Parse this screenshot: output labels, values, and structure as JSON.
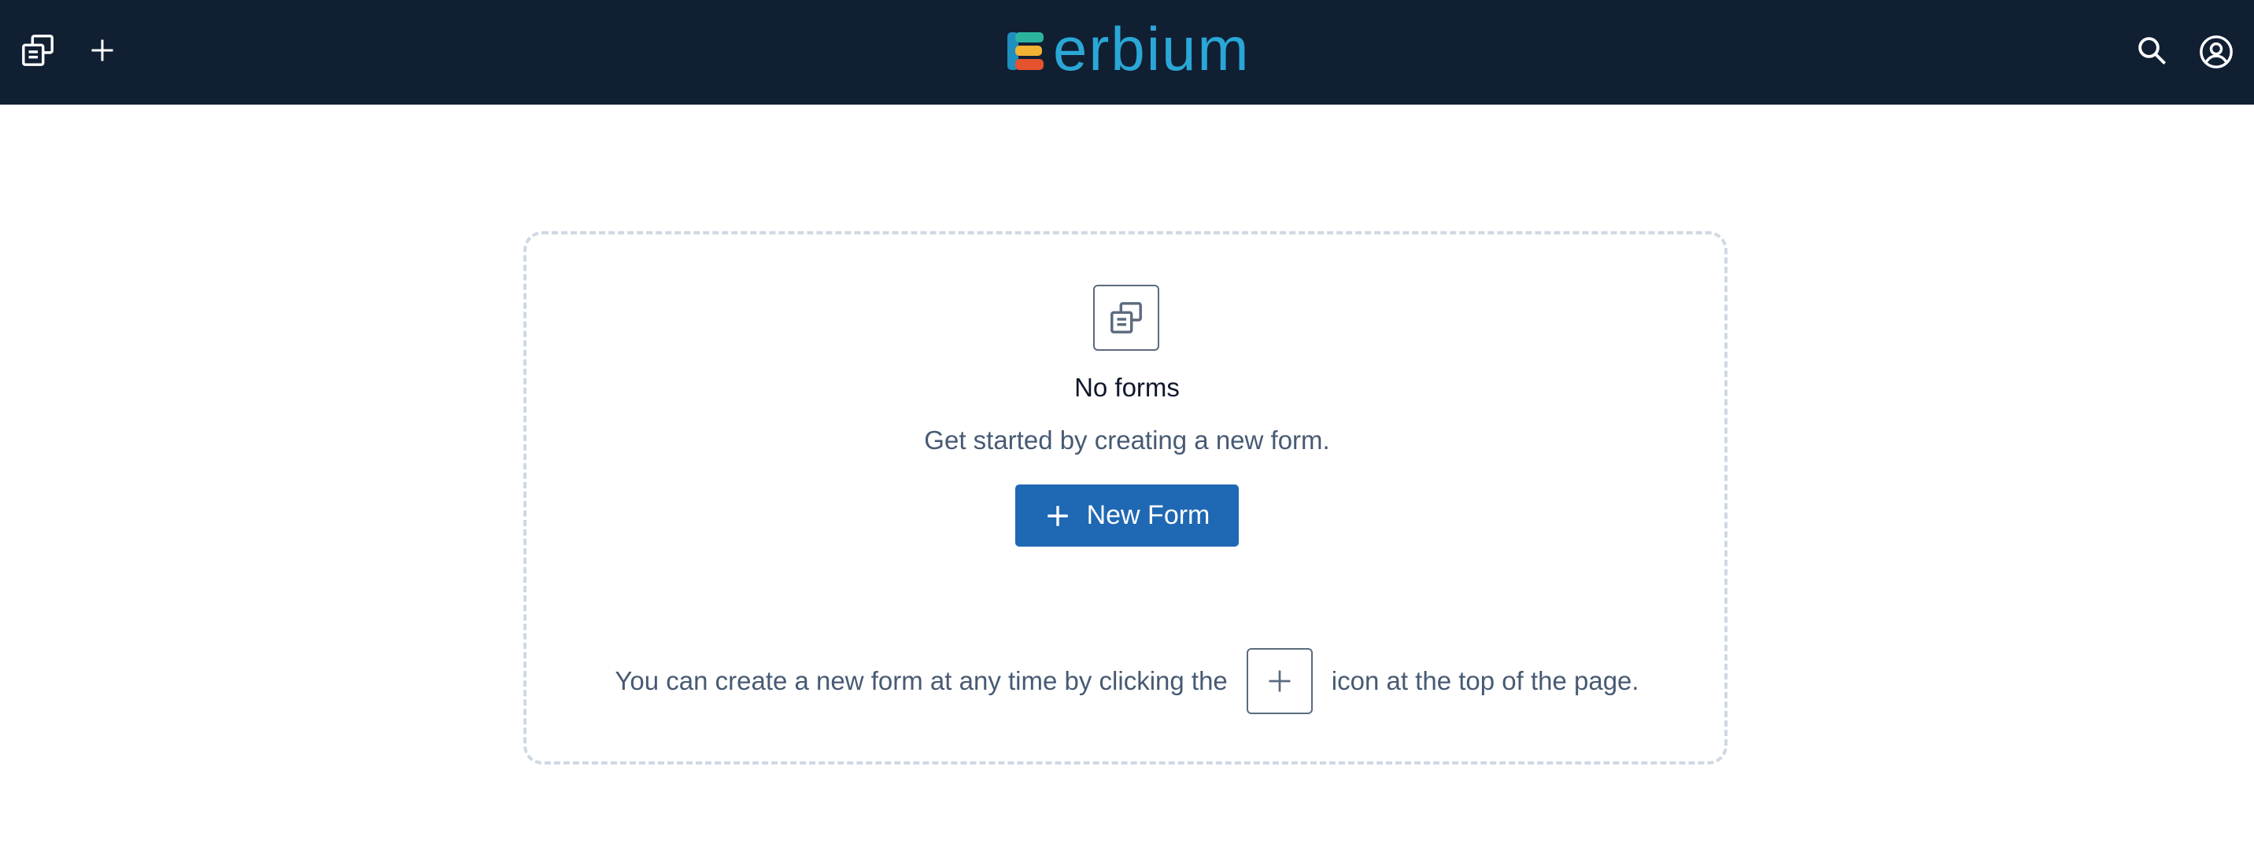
{
  "header": {
    "brand_name": "erbium",
    "icons": {
      "forms": "forms-icon",
      "add": "plus-icon",
      "search": "search-icon",
      "account": "user-circle-icon"
    },
    "colors": {
      "bar": "#111f33",
      "brand_text": "#2aa7d6"
    }
  },
  "empty_state": {
    "title": "No forms",
    "subtitle": "Get started by creating a new form.",
    "button_label": "New Form",
    "hint_before": "You can create a new form at any time by clicking the",
    "hint_after": "icon at the top of the page.",
    "colors": {
      "button": "#1f68b4",
      "muted_text": "#475a73",
      "dashed_border": "#cfd8e3"
    }
  }
}
